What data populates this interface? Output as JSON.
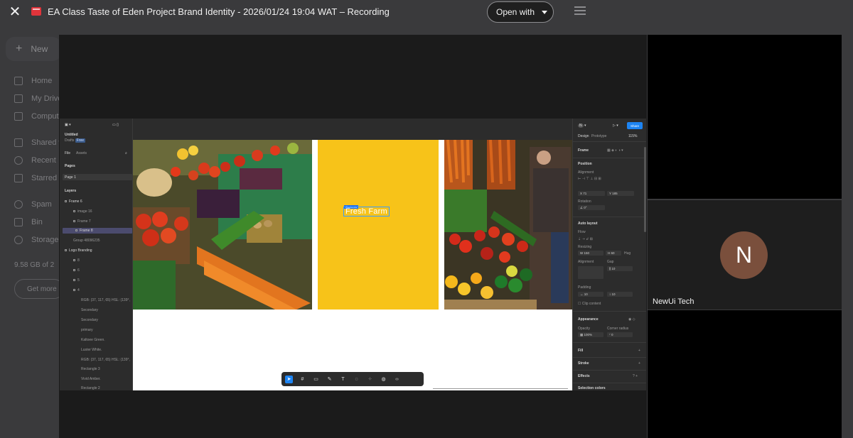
{
  "preview": {
    "title": "EA Class Taste of Eden Project Brand Identity - 2026/01/24 19:04 WAT – Recording",
    "open_with_label": "Open with"
  },
  "drive_background": {
    "new_label": "New",
    "nav": [
      "Home",
      "My Drive",
      "Computers",
      "Shared with me",
      "Recent",
      "Starred",
      "Spam",
      "Bin",
      "Storage"
    ],
    "storage_text": "9.58 GB of 2",
    "get_more_label": "Get more"
  },
  "figma": {
    "file_name": "Untitled",
    "file_location": "Drafts",
    "plan_badge": "Free",
    "tabs": {
      "file": "File",
      "assets": "Assets"
    },
    "pages_label": "Pages",
    "pages": [
      "Page 1"
    ],
    "layers_label": "Layers",
    "layers": [
      "Frame 6",
      "image 16",
      "Frame 7",
      "Frame 8",
      "Group 48096235",
      "Logo Branding",
      "8",
      "6",
      "5",
      "4",
      "RGB: (37, 117, 65) HSL: (139°,",
      "Secondary",
      "Secondary",
      "primary",
      "Kaltoee Green.",
      "Luster White.",
      "RGB: (37, 117, 65) HSL: (139°,",
      "Rectangle 3",
      "Vivid Amber.",
      "Rectangle 2"
    ],
    "canvas": {
      "frame_badge": "Contents",
      "headline": "Fresh Farm"
    },
    "right_panel": {
      "avatar_letter": "N",
      "share_label": "Share",
      "tab_design": "Design",
      "tab_prototype": "Prototype",
      "zoom": "115%",
      "frame_label": "Frame",
      "position_label": "Position",
      "alignment_label": "Alignment",
      "position_x": "71",
      "position_y": "185",
      "rotation_label": "Rotation",
      "rotation_value": "0°",
      "auto_layout_label": "Auto layout",
      "flow_label": "Flow",
      "resizing_label": "Resizing",
      "width_value": "150",
      "height_value": "60",
      "hug_label": "Hug",
      "alignment2_label": "Alignment",
      "gap_label": "Gap",
      "gap_value": "10",
      "padding_label": "Padding",
      "padding_h": "10",
      "padding_v": "10",
      "clip_label": "Clip content",
      "appearance_label": "Appearance",
      "opacity_label": "Opacity",
      "opacity_value": "100%",
      "corner_label": "Corner radius",
      "corner_value": "0",
      "fill_label": "Fill",
      "stroke_label": "Stroke",
      "effects_label": "Effects",
      "selection_colors_label": "Selection colors"
    }
  },
  "participants": [
    {
      "name": "NewUi Tech",
      "initial": "N",
      "avatar_color": "#7a4f3c"
    }
  ]
}
